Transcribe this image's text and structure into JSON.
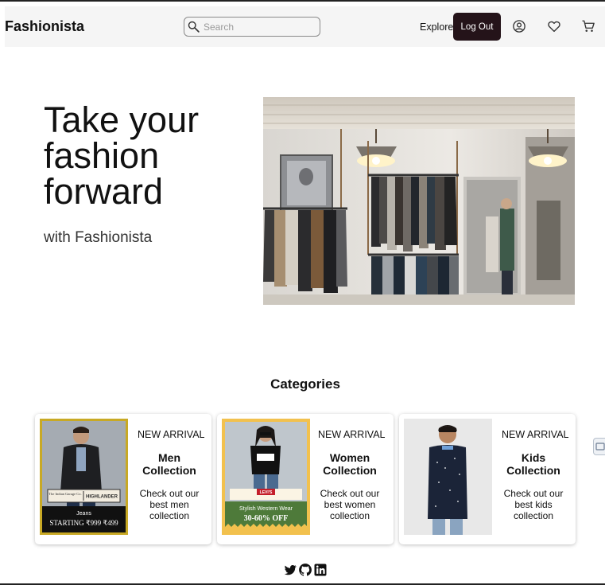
{
  "navbar": {
    "brand": "Fashionista",
    "search_placeholder": "Search",
    "explore_label": "Explore",
    "logout_label": "Log Out",
    "icons": [
      "account-icon",
      "heart-icon",
      "cart-icon"
    ]
  },
  "hero": {
    "title": "Take your fashion forward",
    "subtitle": "with Fashionista"
  },
  "categories": {
    "title": "Categories",
    "cards": [
      {
        "tag": "NEW ARRIVAL",
        "name": "Men Collection",
        "description": "Check out our best men collection",
        "banner": {
          "brand_left": "The Indian Garage Co.",
          "brand_right": "HIGHLANDER",
          "line1": "Jeans",
          "line2": "STARTING ₹999 ₹499"
        }
      },
      {
        "tag": "NEW ARRIVAL",
        "name": "Women Collection",
        "description": "Check out our best women collection",
        "banner": {
          "brand": "LEVI'S",
          "line1": "Stylish Western Wear",
          "line2": "30-60% OFF"
        }
      },
      {
        "tag": "NEW ARRIVAL",
        "name": "Kids Collection",
        "description": "Check out our best kids collection"
      }
    ]
  },
  "footer": {
    "social": [
      "twitter-icon",
      "github-icon",
      "linkedin-icon"
    ]
  },
  "colors": {
    "navbar_bg": "#f5f5f5",
    "logout_bg": "#241319",
    "men_border": "#c8a925",
    "women_border": "#f2c14e",
    "women_banner_green": "#4e7a3a"
  }
}
